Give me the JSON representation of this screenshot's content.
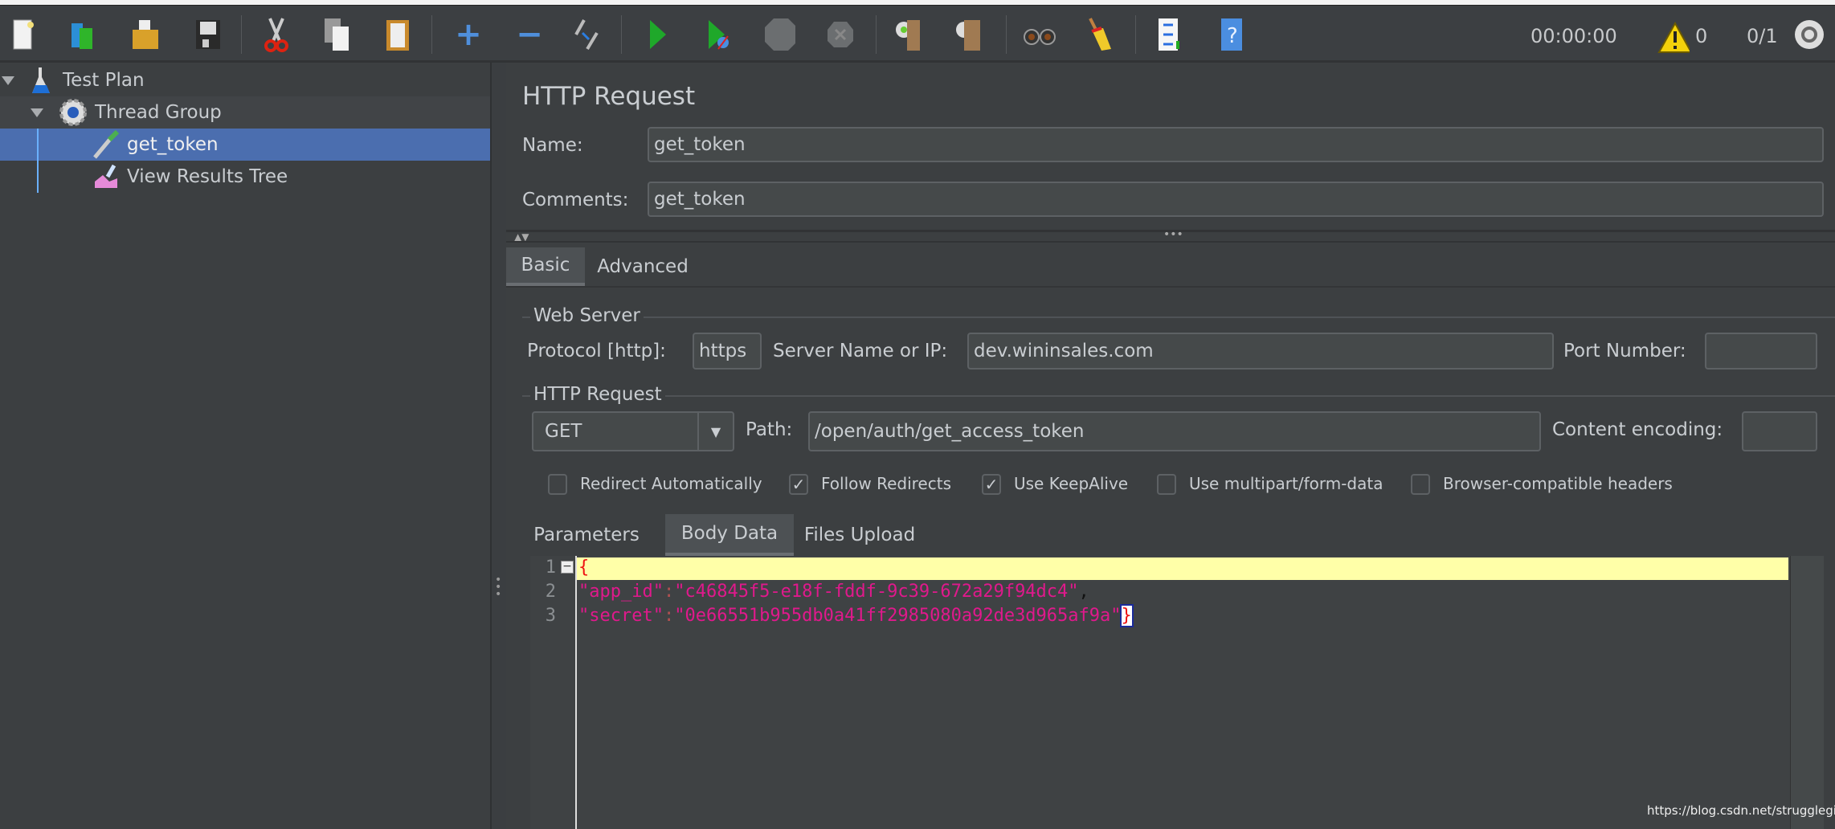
{
  "toolbar": {
    "icons": [
      "new-icon",
      "templates-icon",
      "open-icon",
      "save-icon",
      "cut-icon",
      "copy-icon",
      "paste-icon",
      "expand-icon",
      "collapse-icon",
      "toggle-icon",
      "start-icon",
      "start-no-pauses-icon",
      "stop-icon",
      "shutdown-icon",
      "clear-icon",
      "clear-all-icon",
      "search-icon",
      "reset-search-icon",
      "function-helper-icon",
      "help-icon"
    ],
    "timer": "00:00:00",
    "warnings": "0",
    "threads": "0/1"
  },
  "tree": {
    "items": [
      {
        "label": "Test Plan",
        "icon": "flask-icon"
      },
      {
        "label": "Thread Group",
        "icon": "gear-icon"
      },
      {
        "label": "get_token",
        "icon": "pipette-icon",
        "selected": true
      },
      {
        "label": "View Results Tree",
        "icon": "chart-icon"
      }
    ]
  },
  "panel": {
    "title": "HTTP Request",
    "name_label": "Name:",
    "name_value": "get_token",
    "comments_label": "Comments:",
    "comments_value": "get_token",
    "tabs": [
      "Basic",
      "Advanced"
    ],
    "web_server": {
      "heading": "Web Server",
      "protocol_label": "Protocol [http]:",
      "protocol_value": "https",
      "server_label": "Server Name or IP:",
      "server_value": "dev.wininsales.com",
      "port_label": "Port Number:",
      "port_value": ""
    },
    "http_request": {
      "heading": "HTTP Request",
      "method": "GET",
      "path_label": "Path:",
      "path_value": "/open/auth/get_access_token",
      "encoding_label": "Content encoding:",
      "encoding_value": ""
    },
    "checkboxes": [
      {
        "label": "Redirect Automatically",
        "checked": false
      },
      {
        "label": "Follow Redirects",
        "checked": true
      },
      {
        "label": "Use KeepAlive",
        "checked": true
      },
      {
        "label": "Use multipart/form-data",
        "checked": false
      },
      {
        "label": "Browser-compatible headers",
        "checked": false
      }
    ],
    "subtabs": [
      "Parameters",
      "Body Data",
      "Files Upload"
    ],
    "body": {
      "line_numbers": [
        "1",
        "2",
        "3"
      ],
      "line1": "{",
      "line2_key": "\"app_id\"",
      "line2_colon": ":",
      "line2_val": "\"c46845f5-e18f-fddf-9c39-672a29f94dc4\"",
      "line2_comma": ",",
      "line3_key": "\"secret\"",
      "line3_colon": ":",
      "line3_val": "\"0e66551b955db0a41ff2985080a92de3d965af9a\"",
      "line3_close": "}"
    }
  },
  "watermark": "https://blog.csdn.net/strugglegirl"
}
